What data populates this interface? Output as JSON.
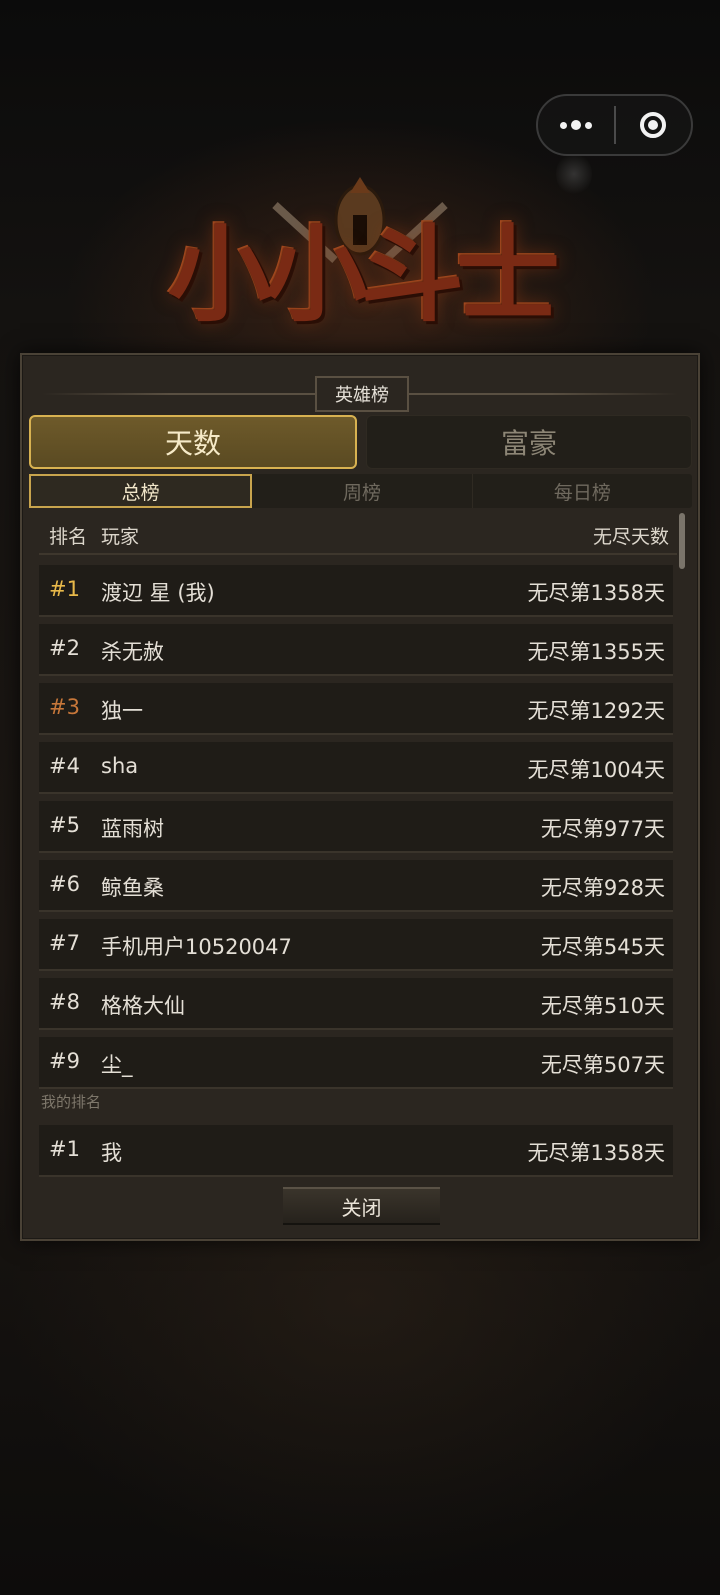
{
  "capsule": {
    "more_icon": "ellipsis-icon",
    "close_icon": "target-circle-icon"
  },
  "logo": {
    "text": "小小斗士"
  },
  "panel": {
    "title": "英雄榜",
    "main_tabs": [
      {
        "label": "天数",
        "active": true
      },
      {
        "label": "富豪",
        "active": false
      }
    ],
    "sub_tabs": [
      {
        "label": "总榜",
        "active": true
      },
      {
        "label": "周榜",
        "active": false
      },
      {
        "label": "每日榜",
        "active": false
      }
    ],
    "header": {
      "rank": "排名",
      "player": "玩家",
      "score": "无尽天数"
    },
    "rows": [
      {
        "rank": "#1",
        "name": "渡辺 星 (我)",
        "score": "无尽第1358天"
      },
      {
        "rank": "#2",
        "name": "杀无赦",
        "score": "无尽第1355天"
      },
      {
        "rank": "#3",
        "name": "独一",
        "score": "无尽第1292天"
      },
      {
        "rank": "#4",
        "name": "sha",
        "score": "无尽第1004天"
      },
      {
        "rank": "#5",
        "name": "蓝雨树",
        "score": "无尽第977天"
      },
      {
        "rank": "#6",
        "name": "鲸鱼桑",
        "score": "无尽第928天"
      },
      {
        "rank": "#7",
        "name": "手机用户10520047",
        "score": "无尽第545天"
      },
      {
        "rank": "#8",
        "name": "格格大仙",
        "score": "无尽第510天"
      },
      {
        "rank": "#9",
        "name": "尘_",
        "score": "无尽第507天"
      }
    ],
    "my_rank_label": "我的排名",
    "my_rank": {
      "rank": "#1",
      "name": "我",
      "score": "无尽第1358天"
    },
    "close_label": "关闭"
  },
  "colors": {
    "gold": "#e8b94a",
    "bronze": "#c7773a",
    "accent_border": "#d8b251"
  }
}
